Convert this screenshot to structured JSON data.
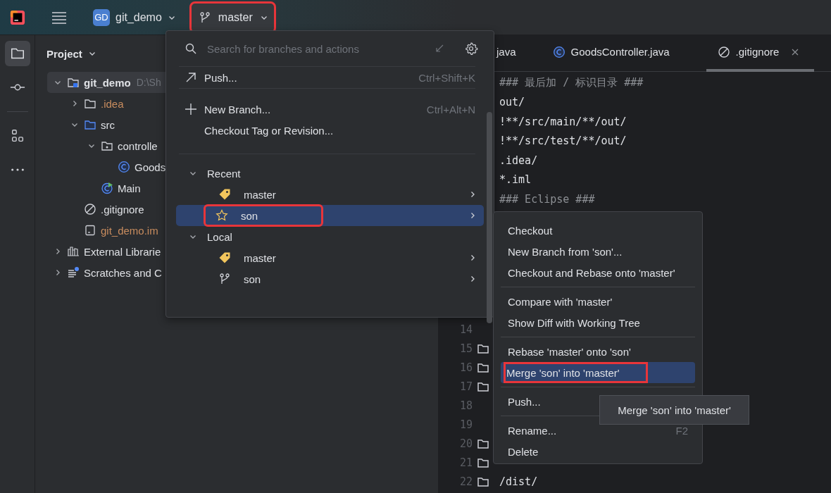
{
  "toolbar": {
    "project_badge": "GD",
    "project": "git_demo",
    "branch": "master",
    "branch_highlighted": true
  },
  "side_tools": [
    {
      "kind": "folder",
      "selected": true
    },
    {
      "kind": "commit",
      "selected": false
    },
    {
      "kind": "structure",
      "selected": false
    },
    {
      "kind": "more",
      "selected": false
    }
  ],
  "project_panel": {
    "title": "Project",
    "tree": [
      {
        "label": "git_demo",
        "kind": "module",
        "hint": "D:\\Sh",
        "expanded": true,
        "selected": true,
        "ignored": false,
        "children": [
          {
            "label": ".idea",
            "kind": "folder",
            "expanded": false,
            "selected": false,
            "ignored": true
          },
          {
            "label": "src",
            "kind": "source_folder",
            "expanded": true,
            "selected": false,
            "ignored": false,
            "children": [
              {
                "label": "controlle",
                "kind": "package",
                "expanded": true,
                "selected": false,
                "ignored": false,
                "children": [
                  {
                    "label": "Goods",
                    "kind": "class",
                    "selected": false,
                    "ignored": false
                  }
                ]
              },
              {
                "label": "Main",
                "kind": "main",
                "selected": false,
                "ignored": false
              }
            ]
          },
          {
            "label": ".gitignore",
            "kind": "ignore_file",
            "selected": false,
            "ignored": false
          },
          {
            "label": "git_demo.im",
            "kind": "iml",
            "selected": false,
            "ignored": true
          }
        ]
      },
      {
        "label": "External Librarie",
        "kind": "libraries",
        "expanded": false,
        "selected": false,
        "ignored": false
      },
      {
        "label": "Scratches and C",
        "kind": "scratches",
        "expanded": false,
        "selected": false,
        "ignored": false
      }
    ]
  },
  "editor": {
    "tabs": [
      {
        "label": "java",
        "kind": "plain",
        "selected": false,
        "closable": false
      },
      {
        "label": "GoodsController.java",
        "kind": "class",
        "selected": false,
        "closable": false
      },
      {
        "label": ".gitignore",
        "kind": "ignore_file",
        "selected": true,
        "closable": true
      }
    ],
    "top_lines": [
      {
        "text": "### 最后加 / 标识目录 ###",
        "comment": true
      },
      {
        "text": "out/",
        "comment": false
      },
      {
        "text": "!**/src/main/**/out/",
        "comment": false
      },
      {
        "text": "!**/src/test/**/out/",
        "comment": false
      },
      {
        "text": ".idea/",
        "comment": false
      },
      {
        "text": "*.iml",
        "comment": false
      },
      {
        "text": "### Eclipse ###",
        "comment": true
      }
    ],
    "bottom_lines": [
      {
        "number": "14",
        "folder": false
      },
      {
        "number": "15",
        "folder": true
      },
      {
        "number": "16",
        "folder": true
      },
      {
        "number": "17",
        "folder": true
      },
      {
        "number": "18",
        "folder": false
      },
      {
        "number": "19",
        "folder": false
      },
      {
        "number": "20",
        "folder": true
      },
      {
        "number": "21",
        "folder": true
      },
      {
        "number": "22",
        "folder": true,
        "text": "/dist/"
      }
    ]
  },
  "branch_popup": {
    "search": {
      "placeholder": "Search for branches and actions"
    },
    "action_groups": [
      [
        {
          "label": "Push...",
          "kind": "push",
          "shortcut": "Ctrl+Shift+K"
        }
      ],
      [
        {
          "label": "New Branch...",
          "kind": "new",
          "shortcut": "Ctrl+Alt+N"
        },
        {
          "label": "Checkout Tag or Revision...",
          "kind": "checkout"
        }
      ]
    ],
    "branch_groups": [
      {
        "label": "Recent",
        "expanded": true,
        "branches": [
          {
            "name": "master",
            "kind": "current",
            "selected": false,
            "highlighted": false
          },
          {
            "name": "son",
            "kind": "favorite",
            "selected": true,
            "highlighted": true
          }
        ]
      },
      {
        "label": "Local",
        "expanded": true,
        "branches": [
          {
            "name": "master",
            "kind": "current",
            "selected": false,
            "highlighted": false
          },
          {
            "name": "son",
            "kind": "branch",
            "selected": false,
            "highlighted": false
          }
        ]
      }
    ]
  },
  "context_menu": {
    "sections": [
      [
        {
          "label": "Checkout",
          "selected": false,
          "highlighted": false
        },
        {
          "label": "New Branch from 'son'...",
          "selected": false,
          "highlighted": false
        },
        {
          "label": "Checkout and Rebase onto 'master'",
          "selected": false,
          "highlighted": false
        }
      ],
      [
        {
          "label": "Compare with 'master'",
          "selected": false,
          "highlighted": false
        },
        {
          "label": "Show Diff with Working Tree",
          "selected": false,
          "highlighted": false
        }
      ],
      [
        {
          "label": "Rebase 'master' onto 'son'",
          "selected": false,
          "highlighted": false
        },
        {
          "label": "Merge 'son' into 'master'",
          "selected": true,
          "highlighted": true
        }
      ],
      [
        {
          "label": "Push...",
          "selected": false,
          "highlighted": false
        }
      ],
      [
        {
          "label": "Rename...",
          "shortcut": "F2",
          "selected": false,
          "highlighted": false
        },
        {
          "label": "Delete",
          "selected": false,
          "highlighted": false
        }
      ]
    ]
  },
  "tooltip": {
    "text": "Merge 'son' into 'master'"
  }
}
